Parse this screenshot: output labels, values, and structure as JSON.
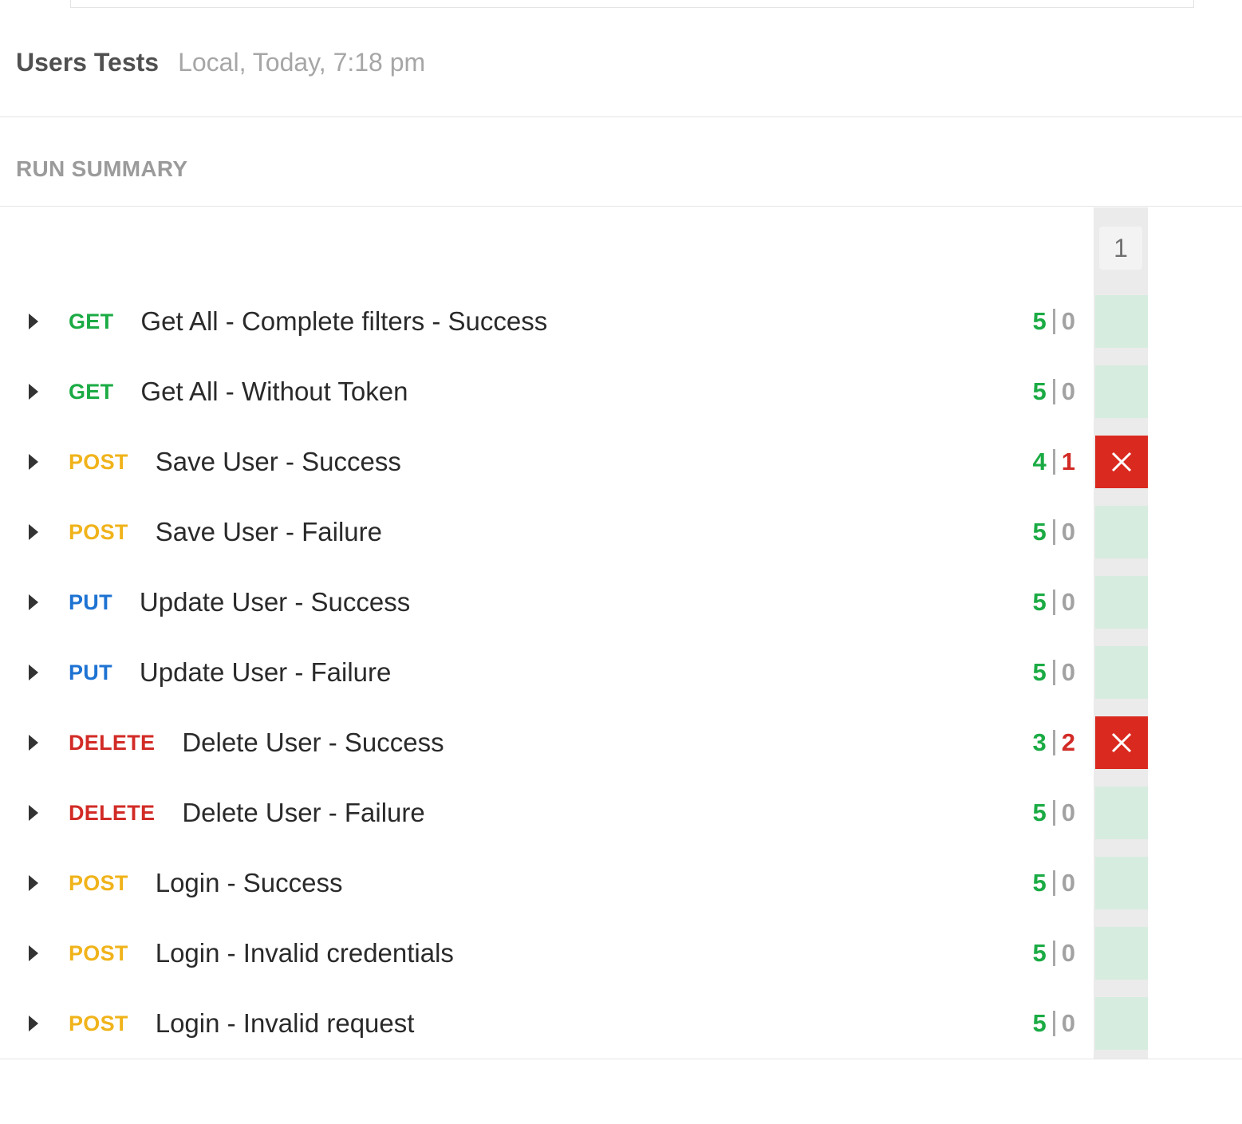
{
  "header": {
    "run_name": "Users Tests",
    "run_meta": "Local, Today, 7:18 pm"
  },
  "summary": {
    "title": "RUN SUMMARY",
    "iteration_label": "1"
  },
  "colors": {
    "pass": "#1bab44",
    "fail": "#d22b26",
    "get": "#1bab44",
    "post": "#f0b31a",
    "put": "#1e73d2",
    "delete": "#d22b26",
    "pass_cell": "#d6ecdf",
    "fail_cell": "#da2a20"
  },
  "requests": [
    {
      "method": "GET",
      "name": "Get All - Complete filters - Success",
      "passed": "5",
      "failed": "0",
      "status": "pass"
    },
    {
      "method": "GET",
      "name": "Get All - Without Token",
      "passed": "5",
      "failed": "0",
      "status": "pass"
    },
    {
      "method": "POST",
      "name": "Save User - Success",
      "passed": "4",
      "failed": "1",
      "status": "fail"
    },
    {
      "method": "POST",
      "name": "Save User - Failure",
      "passed": "5",
      "failed": "0",
      "status": "pass"
    },
    {
      "method": "PUT",
      "name": "Update User - Success",
      "passed": "5",
      "failed": "0",
      "status": "pass"
    },
    {
      "method": "PUT",
      "name": "Update User - Failure",
      "passed": "5",
      "failed": "0",
      "status": "pass"
    },
    {
      "method": "DELETE",
      "name": "Delete User - Success",
      "passed": "3",
      "failed": "2",
      "status": "fail"
    },
    {
      "method": "DELETE",
      "name": "Delete User - Failure",
      "passed": "5",
      "failed": "0",
      "status": "pass"
    },
    {
      "method": "POST",
      "name": "Login - Success",
      "passed": "5",
      "failed": "0",
      "status": "pass"
    },
    {
      "method": "POST",
      "name": "Login - Invalid credentials",
      "passed": "5",
      "failed": "0",
      "status": "pass"
    },
    {
      "method": "POST",
      "name": "Login - Invalid request",
      "passed": "5",
      "failed": "0",
      "status": "pass"
    }
  ]
}
